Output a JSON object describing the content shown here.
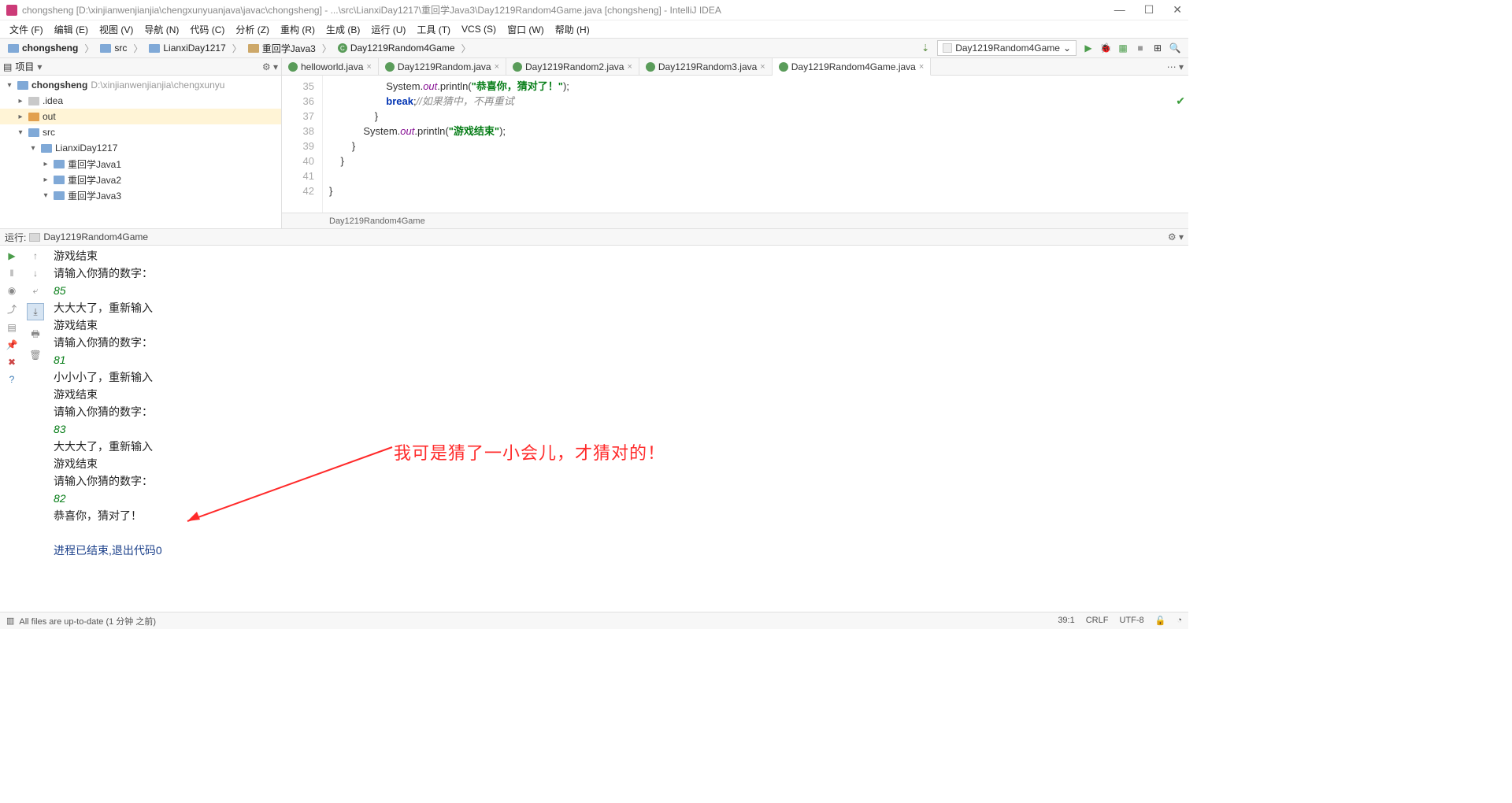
{
  "window": {
    "title": "chongsheng [D:\\xinjianwenjianjia\\chengxunyuanjava\\javac\\chongsheng] - ...\\src\\LianxiDay1217\\重回学Java3\\Day1219Random4Game.java [chongsheng] - IntelliJ IDEA"
  },
  "menu": [
    "文件 (F)",
    "编辑 (E)",
    "视图 (V)",
    "导航 (N)",
    "代码 (C)",
    "分析 (Z)",
    "重构 (R)",
    "生成 (B)",
    "运行 (U)",
    "工具 (T)",
    "VCS (S)",
    "窗口 (W)",
    "帮助 (H)"
  ],
  "breadcrumbs": [
    {
      "label": "chongsheng",
      "type": "folder"
    },
    {
      "label": "src",
      "type": "folder"
    },
    {
      "label": "LianxiDay1217",
      "type": "folder"
    },
    {
      "label": "重回学Java3",
      "type": "pkg"
    },
    {
      "label": "Day1219Random4Game",
      "type": "class"
    }
  ],
  "run_config": "Day1219Random4Game",
  "sidebar": {
    "title": "项目",
    "tree": [
      {
        "arrow": "▾",
        "label": "chongsheng",
        "dim": "D:\\xinjianwenjianjia\\chengxunyu",
        "indent": 0,
        "icon": "folder",
        "bold": true
      },
      {
        "arrow": "▸",
        "label": ".idea",
        "indent": 1,
        "icon": "grey"
      },
      {
        "arrow": "▸",
        "label": "out",
        "indent": 1,
        "icon": "orange",
        "sel": true
      },
      {
        "arrow": "▾",
        "label": "src",
        "indent": 1,
        "icon": "folder"
      },
      {
        "arrow": "▾",
        "label": "LianxiDay1217",
        "indent": 2,
        "icon": "folder"
      },
      {
        "arrow": "▸",
        "label": "重回学Java1",
        "indent": 3,
        "icon": "folder"
      },
      {
        "arrow": "▸",
        "label": "重回学Java2",
        "indent": 3,
        "icon": "folder"
      },
      {
        "arrow": "▾",
        "label": "重回学Java3",
        "indent": 3,
        "icon": "folder"
      }
    ]
  },
  "editor": {
    "tabs": [
      {
        "label": "helloworld.java",
        "active": false
      },
      {
        "label": "Day1219Random.java",
        "active": false
      },
      {
        "label": "Day1219Random2.java",
        "active": false
      },
      {
        "label": "Day1219Random3.java",
        "active": false
      },
      {
        "label": "Day1219Random4Game.java",
        "active": true
      }
    ],
    "gutter": [
      "35",
      "36",
      "37",
      "38",
      "39",
      "40",
      "41",
      "42"
    ],
    "code": {
      "l35": {
        "pre": "                    System.",
        "fld": "out",
        "mid": ".println(",
        "str": "\"恭喜你，猜对了！\"",
        "end": ");"
      },
      "l36": {
        "pre": "                    ",
        "kw": "break",
        "mid": ";",
        "cmt": "//如果猜中，不再重试"
      },
      "l37": "                }",
      "l38": {
        "pre": "            System.",
        "fld": "out",
        "mid": ".println(",
        "str": "\"游戏结束\"",
        "end": ");"
      },
      "l39": "        }",
      "l40": "    }",
      "l41": "",
      "l42": "}"
    },
    "crumb": "Day1219Random4Game"
  },
  "run_panel": {
    "label": "运行:",
    "name": "Day1219Random4Game",
    "lines": [
      {
        "t": "游戏结束",
        "c": "dim"
      },
      {
        "t": "请输入你猜的数字：",
        "c": ""
      },
      {
        "t": "85",
        "c": "input"
      },
      {
        "t": "大大大了，重新输入",
        "c": ""
      },
      {
        "t": "游戏结束",
        "c": ""
      },
      {
        "t": "请输入你猜的数字：",
        "c": ""
      },
      {
        "t": "81",
        "c": "input"
      },
      {
        "t": "小小小了，重新输入",
        "c": ""
      },
      {
        "t": "游戏结束",
        "c": ""
      },
      {
        "t": "请输入你猜的数字：",
        "c": ""
      },
      {
        "t": "83",
        "c": "input"
      },
      {
        "t": "大大大了，重新输入",
        "c": ""
      },
      {
        "t": "游戏结束",
        "c": ""
      },
      {
        "t": "请输入你猜的数字：",
        "c": ""
      },
      {
        "t": "82",
        "c": "input"
      },
      {
        "t": "恭喜你，猜对了！",
        "c": ""
      },
      {
        "t": "",
        "c": ""
      },
      {
        "t": "进程已结束,退出代码0",
        "c": "exit"
      }
    ],
    "annotation": "我可是猜了一小会儿，才猜对的！"
  },
  "status": {
    "left": "All files are up-to-date (1 分钟 之前)",
    "pos": "39:1",
    "eol": "CRLF",
    "enc": "UTF-8"
  }
}
